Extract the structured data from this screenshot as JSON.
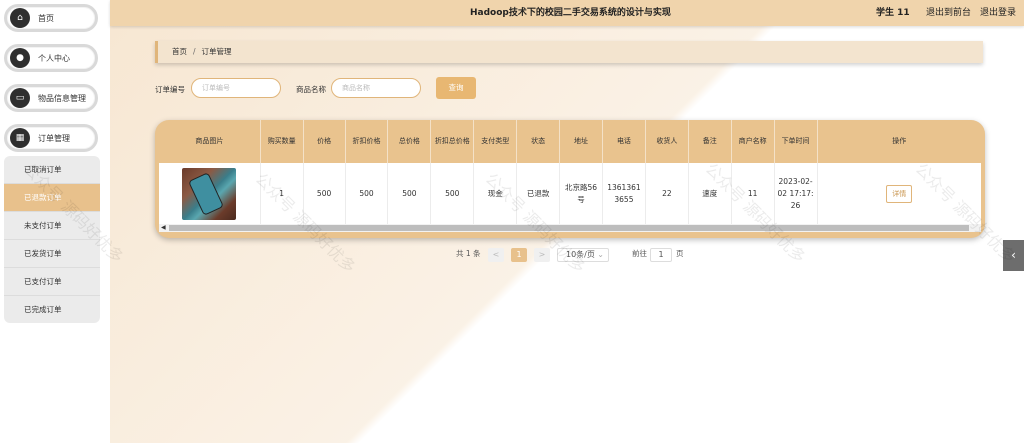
{
  "header": {
    "title": "Hadoop技术下的校园二手交易系统的设计与实现",
    "user": "学生 11",
    "front_link": "退出到前台",
    "logout_link": "退出登录"
  },
  "sidebar": {
    "items": [
      {
        "label": "首页",
        "icon": "home-icon"
      },
      {
        "label": "个人中心",
        "icon": "user-icon"
      },
      {
        "label": "物品信息管理",
        "icon": "monitor-icon"
      },
      {
        "label": "订单管理",
        "icon": "grid-icon"
      }
    ],
    "submenu": [
      {
        "label": "已取消订单",
        "active": false
      },
      {
        "label": "已退款订单",
        "active": true
      },
      {
        "label": "未支付订单",
        "active": false
      },
      {
        "label": "已发货订单",
        "active": false
      },
      {
        "label": "已支付订单",
        "active": false
      },
      {
        "label": "已完成订单",
        "active": false
      }
    ]
  },
  "breadcrumb": {
    "home": "首页",
    "separator": "/",
    "current": "订单管理"
  },
  "search": {
    "order_no_label": "订单编号",
    "order_no_placeholder": "订单编号",
    "product_label": "商品名称",
    "product_placeholder": "商品名称",
    "search_button": "查询"
  },
  "table": {
    "headers": [
      "商品图片",
      "购买数量",
      "价格",
      "折扣价格",
      "总价格",
      "折扣总价格",
      "支付类型",
      "状态",
      "地址",
      "电话",
      "收货人",
      "备注",
      "商户名称",
      "下单时间",
      "操作"
    ],
    "row": {
      "quantity": "1",
      "price": "500",
      "discount_price": "500",
      "total": "500",
      "discount_total": "500",
      "pay_type": "现金",
      "status": "已退款",
      "address": "北京路56号",
      "phone": "13613613655",
      "receiver": "22",
      "remark": "速度",
      "merchant": "11",
      "order_time": "2023-02-02 17:17:26",
      "action": "详情"
    }
  },
  "pagination": {
    "total_text": "共 1 条",
    "prev": "<",
    "current_page": "1",
    "next": ">",
    "page_size": "10条/页",
    "goto_label": "前往",
    "goto_value": "1",
    "page_suffix": "页"
  },
  "side_tab": {
    "icon": "chevron-left-icon",
    "glyph": "‹"
  },
  "colors": {
    "accent": "#e8c18c",
    "header": "#f0d4ac",
    "button": "#e8b772"
  },
  "watermark": "公众号 源码好优多"
}
